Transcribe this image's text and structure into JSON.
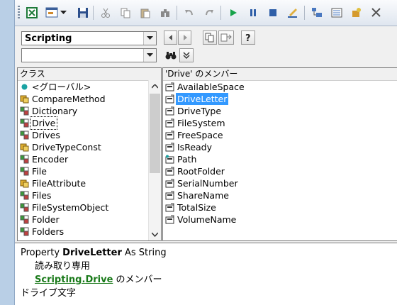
{
  "toolbar": {
    "buttons": [
      "excel-icon",
      "userform-icon",
      "dropdown-arrow-icon",
      "save-icon",
      "cut-icon",
      "copy-icon",
      "paste-icon",
      "find-icon",
      "undo-icon",
      "redo-icon",
      "run-icon",
      "pause-icon",
      "stop-icon",
      "design-mode-icon",
      "project-explorer-icon",
      "properties-icon",
      "object-browser-icon",
      "toolbox-icon"
    ]
  },
  "browser": {
    "library": "Scripting",
    "search": "",
    "classes_header": "クラス",
    "members_header": "'Drive' のメンバー",
    "classes": [
      {
        "label": "<グローバル>",
        "icon": "globe-icon"
      },
      {
        "label": "CompareMethod",
        "icon": "enum-icon"
      },
      {
        "label": "Dictionary",
        "icon": "class-icon"
      },
      {
        "label": "Drive",
        "icon": "class-icon"
      },
      {
        "label": "Drives",
        "icon": "class-icon"
      },
      {
        "label": "DriveTypeConst",
        "icon": "enum-icon"
      },
      {
        "label": "Encoder",
        "icon": "class-icon"
      },
      {
        "label": "File",
        "icon": "class-icon"
      },
      {
        "label": "FileAttribute",
        "icon": "enum-icon"
      },
      {
        "label": "Files",
        "icon": "class-icon"
      },
      {
        "label": "FileSystemObject",
        "icon": "class-icon"
      },
      {
        "label": "Folder",
        "icon": "class-icon"
      },
      {
        "label": "Folders",
        "icon": "class-icon"
      }
    ],
    "selected_class": "Drive",
    "members": [
      {
        "label": "AvailableSpace",
        "icon": "property-icon"
      },
      {
        "label": "DriveLetter",
        "icon": "property-icon"
      },
      {
        "label": "DriveType",
        "icon": "property-icon"
      },
      {
        "label": "FileSystem",
        "icon": "property-icon"
      },
      {
        "label": "FreeSpace",
        "icon": "property-icon"
      },
      {
        "label": "IsReady",
        "icon": "property-icon"
      },
      {
        "label": "Path",
        "icon": "default-property-icon"
      },
      {
        "label": "RootFolder",
        "icon": "property-icon"
      },
      {
        "label": "SerialNumber",
        "icon": "property-icon"
      },
      {
        "label": "ShareName",
        "icon": "property-icon"
      },
      {
        "label": "TotalSize",
        "icon": "property-icon"
      },
      {
        "label": "VolumeName",
        "icon": "property-icon"
      }
    ],
    "selected_member": "DriveLetter"
  },
  "details": {
    "prefix": "Property ",
    "member_name": "DriveLetter",
    "suffix": " As String",
    "readonly": "読み取り専用",
    "library_link": "Scripting",
    "dot": ".",
    "class_link": "Drive",
    "member_of": " のメンバー",
    "description": "ドライブ文字"
  },
  "colors": {
    "selection": "#3399ff",
    "link": "#1a7a1a"
  }
}
